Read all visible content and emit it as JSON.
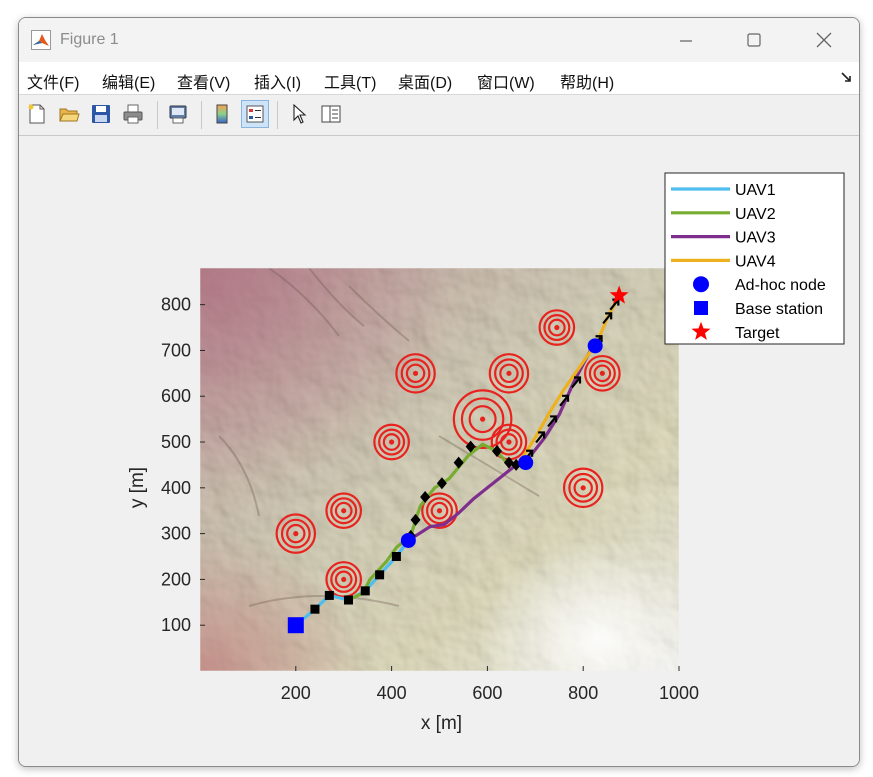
{
  "window": {
    "title": "Figure 1",
    "icon": "matlab-icon"
  },
  "menu": [
    "文件(F)",
    "编辑(E)",
    "查看(V)",
    "插入(I)",
    "工具(T)",
    "桌面(D)",
    "窗口(W)",
    "帮助(H)"
  ],
  "toolbar": [
    "new-figure-icon",
    "open-file-icon",
    "save-icon",
    "print-icon",
    "print-preview-icon",
    "colorbar-icon",
    "legend-icon",
    "pointer-icon",
    "property-inspector-icon"
  ],
  "chart_data": {
    "type": "line",
    "xlabel": "x [m]",
    "ylabel": "y [m]",
    "xlim": [
      0,
      1000
    ],
    "ylim": [
      0,
      880
    ],
    "xticks": [
      200,
      400,
      600,
      800,
      1000
    ],
    "yticks": [
      100,
      200,
      300,
      400,
      500,
      600,
      700,
      800
    ],
    "background": "terrain shaded relief map",
    "legend_position": "top-right",
    "series": [
      {
        "name": "UAV1",
        "color": "#4DBEEE",
        "x": [
          200,
          240,
          270,
          310,
          345,
          375,
          410,
          435
        ],
        "y": [
          100,
          135,
          165,
          155,
          175,
          210,
          250,
          285
        ]
      },
      {
        "name": "UAV2",
        "color": "#77AC30",
        "x": [
          310,
          340,
          355,
          390,
          410,
          440,
          450,
          460,
          490,
          520,
          560,
          590,
          620,
          640,
          665,
          680
        ],
        "y": [
          155,
          170,
          200,
          240,
          270,
          295,
          330,
          360,
          400,
          420,
          470,
          495,
          480,
          455,
          450,
          460
        ]
      },
      {
        "name": "UAV3",
        "color": "#7E2F8E",
        "x": [
          435,
          480,
          510,
          540,
          570,
          600,
          630,
          660,
          690,
          720,
          750,
          780,
          820
        ],
        "y": [
          285,
          315,
          320,
          345,
          375,
          400,
          425,
          450,
          470,
          510,
          560,
          630,
          710
        ]
      },
      {
        "name": "UAV4",
        "color": "#EDB120",
        "x": [
          670,
          700,
          730,
          760,
          790,
          810,
          830,
          850,
          875
        ],
        "y": [
          460,
          510,
          565,
          615,
          660,
          690,
          720,
          770,
          820
        ]
      }
    ],
    "markers": {
      "adhoc_nodes": {
        "name": "Ad-hoc node",
        "color": "#0000FF",
        "points": [
          [
            435,
            285
          ],
          [
            680,
            455
          ],
          [
            825,
            710
          ]
        ]
      },
      "base_station": {
        "name": "Base station",
        "color": "#0000FF",
        "points": [
          [
            200,
            100
          ]
        ]
      },
      "target": {
        "name": "Target",
        "color": "#FF0000",
        "points": [
          [
            875,
            820
          ]
        ]
      },
      "waypoints_square": [
        [
          240,
          135
        ],
        [
          270,
          165
        ],
        [
          310,
          155
        ],
        [
          345,
          175
        ],
        [
          375,
          210
        ],
        [
          410,
          250
        ]
      ],
      "waypoints_diamond": [
        [
          440,
          295
        ],
        [
          450,
          330
        ],
        [
          470,
          380
        ],
        [
          505,
          410
        ],
        [
          540,
          455
        ],
        [
          565,
          490
        ],
        [
          620,
          480
        ],
        [
          645,
          455
        ],
        [
          660,
          450
        ]
      ],
      "waypoints_arrow": [
        [
          685,
          470
        ],
        [
          710,
          510
        ],
        [
          735,
          545
        ],
        [
          760,
          590
        ],
        [
          785,
          630
        ],
        [
          830,
          720
        ],
        [
          850,
          770
        ],
        [
          865,
          800
        ]
      ]
    },
    "threat_zones": [
      {
        "x": 450,
        "y": 650,
        "r": 40
      },
      {
        "x": 645,
        "y": 650,
        "r": 40
      },
      {
        "x": 745,
        "y": 750,
        "r": 36
      },
      {
        "x": 840,
        "y": 650,
        "r": 36
      },
      {
        "x": 590,
        "y": 550,
        "r": 60
      },
      {
        "x": 400,
        "y": 500,
        "r": 36
      },
      {
        "x": 645,
        "y": 500,
        "r": 36
      },
      {
        "x": 300,
        "y": 350,
        "r": 36
      },
      {
        "x": 500,
        "y": 350,
        "r": 36
      },
      {
        "x": 800,
        "y": 400,
        "r": 40
      },
      {
        "x": 200,
        "y": 300,
        "r": 40
      },
      {
        "x": 300,
        "y": 200,
        "r": 36
      }
    ]
  }
}
